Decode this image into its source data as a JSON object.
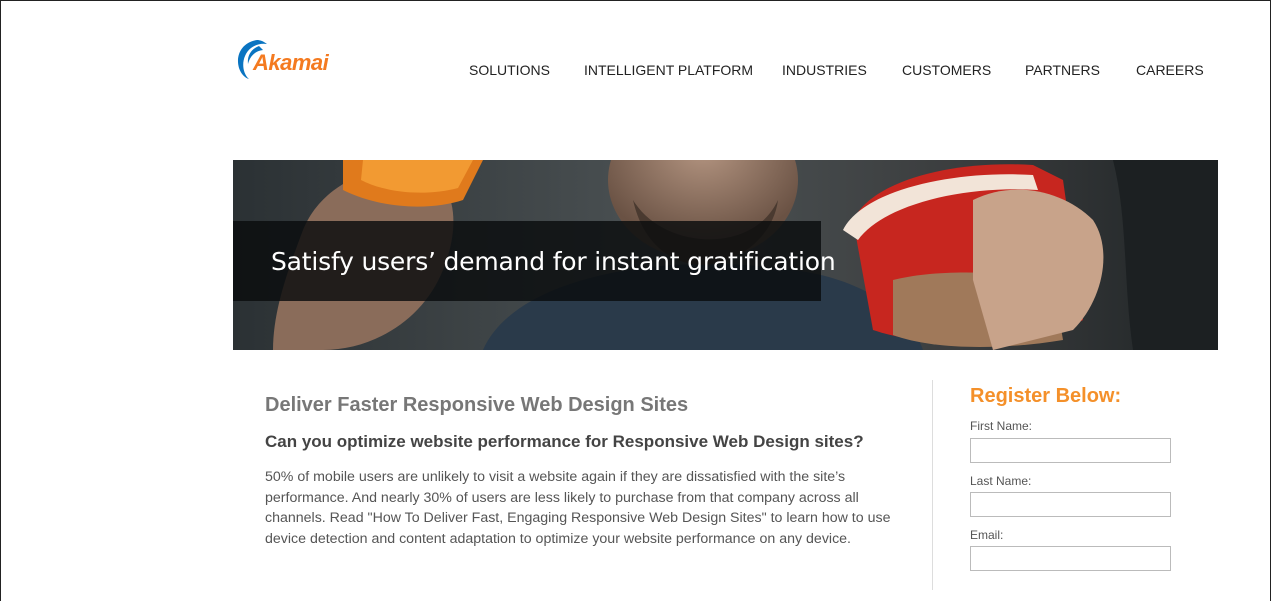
{
  "brand": {
    "name": "Akamai",
    "color": "#f47a20"
  },
  "nav": {
    "items": [
      {
        "label": "SOLUTIONS"
      },
      {
        "label": "INTELLIGENT PLATFORM"
      },
      {
        "label": "INDUSTRIES"
      },
      {
        "label": "CUSTOMERS"
      },
      {
        "label": "PARTNERS"
      },
      {
        "label": "CAREERS"
      }
    ]
  },
  "hero": {
    "caption": "Satisfy users’ demand for instant gratification"
  },
  "content": {
    "title": "Deliver Faster Responsive Web Design Sites",
    "subtitle": "Can you optimize website performance for Responsive Web Design sites?",
    "body": "50% of mobile users are unlikely to visit a website again if they are dissatisfied with the site’s performance. And nearly 30% of users are less likely to purchase from that company across all channels. Read \"How To Deliver Fast, Engaging Responsive Web Design Sites\" to learn how to use device detection and content adaptation to optimize your website performance on any device."
  },
  "form": {
    "title": "Register Below:",
    "accent": "#f4902a",
    "fields": [
      {
        "label": "First Name:",
        "value": ""
      },
      {
        "label": "Last Name:",
        "value": ""
      },
      {
        "label": "Email:",
        "value": ""
      }
    ]
  }
}
